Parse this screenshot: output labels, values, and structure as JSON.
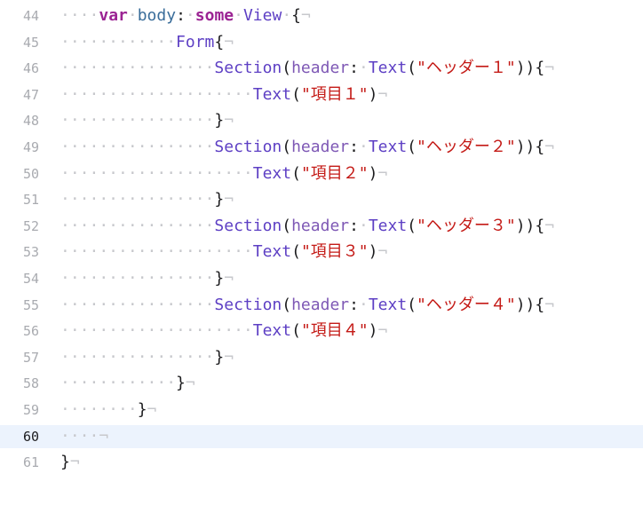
{
  "editor": {
    "lines": [
      {
        "num": "44",
        "indent": "····",
        "segments": [
          [
            "kw",
            "var"
          ],
          [
            "ws",
            "·"
          ],
          [
            "prop",
            "body"
          ],
          [
            "punc",
            ":"
          ],
          [
            "ws",
            "·"
          ],
          [
            "kw",
            "some"
          ],
          [
            "ws",
            "·"
          ],
          [
            "type",
            "View"
          ],
          [
            "ws",
            "·"
          ],
          [
            "punc",
            "{"
          ],
          [
            "eol",
            "¬"
          ]
        ]
      },
      {
        "num": "45",
        "indent": "············",
        "segments": [
          [
            "type",
            "Form"
          ],
          [
            "punc",
            "{"
          ],
          [
            "eol",
            "¬"
          ]
        ]
      },
      {
        "num": "46",
        "indent": "················",
        "segments": [
          [
            "type",
            "Section"
          ],
          [
            "punc",
            "("
          ],
          [
            "param",
            "header"
          ],
          [
            "punc",
            ":"
          ],
          [
            "ws",
            "·"
          ],
          [
            "type",
            "Text"
          ],
          [
            "punc",
            "("
          ],
          [
            "str",
            "\"ヘッダー１\""
          ],
          [
            "punc",
            "))"
          ],
          [
            "punc",
            "{"
          ],
          [
            "eol",
            "¬"
          ]
        ]
      },
      {
        "num": "47",
        "indent": "····················",
        "segments": [
          [
            "type",
            "Text"
          ],
          [
            "punc",
            "("
          ],
          [
            "str",
            "\"項目１\""
          ],
          [
            "punc",
            ")"
          ],
          [
            "eol",
            "¬"
          ]
        ]
      },
      {
        "num": "48",
        "indent": "················",
        "segments": [
          [
            "punc",
            "}"
          ],
          [
            "eol",
            "¬"
          ]
        ]
      },
      {
        "num": "49",
        "indent": "················",
        "segments": [
          [
            "type",
            "Section"
          ],
          [
            "punc",
            "("
          ],
          [
            "param",
            "header"
          ],
          [
            "punc",
            ":"
          ],
          [
            "ws",
            "·"
          ],
          [
            "type",
            "Text"
          ],
          [
            "punc",
            "("
          ],
          [
            "str",
            "\"ヘッダー２\""
          ],
          [
            "punc",
            "))"
          ],
          [
            "punc",
            "{"
          ],
          [
            "eol",
            "¬"
          ]
        ]
      },
      {
        "num": "50",
        "indent": "····················",
        "segments": [
          [
            "type",
            "Text"
          ],
          [
            "punc",
            "("
          ],
          [
            "str",
            "\"項目２\""
          ],
          [
            "punc",
            ")"
          ],
          [
            "eol",
            "¬"
          ]
        ]
      },
      {
        "num": "51",
        "indent": "················",
        "segments": [
          [
            "punc",
            "}"
          ],
          [
            "eol",
            "¬"
          ]
        ]
      },
      {
        "num": "52",
        "indent": "················",
        "segments": [
          [
            "type",
            "Section"
          ],
          [
            "punc",
            "("
          ],
          [
            "param",
            "header"
          ],
          [
            "punc",
            ":"
          ],
          [
            "ws",
            "·"
          ],
          [
            "type",
            "Text"
          ],
          [
            "punc",
            "("
          ],
          [
            "str",
            "\"ヘッダー３\""
          ],
          [
            "punc",
            "))"
          ],
          [
            "punc",
            "{"
          ],
          [
            "eol",
            "¬"
          ]
        ]
      },
      {
        "num": "53",
        "indent": "····················",
        "segments": [
          [
            "type",
            "Text"
          ],
          [
            "punc",
            "("
          ],
          [
            "str",
            "\"項目３\""
          ],
          [
            "punc",
            ")"
          ],
          [
            "eol",
            "¬"
          ]
        ]
      },
      {
        "num": "54",
        "indent": "················",
        "segments": [
          [
            "punc",
            "}"
          ],
          [
            "eol",
            "¬"
          ]
        ]
      },
      {
        "num": "55",
        "indent": "················",
        "segments": [
          [
            "type",
            "Section"
          ],
          [
            "punc",
            "("
          ],
          [
            "param",
            "header"
          ],
          [
            "punc",
            ":"
          ],
          [
            "ws",
            "·"
          ],
          [
            "type",
            "Text"
          ],
          [
            "punc",
            "("
          ],
          [
            "str",
            "\"ヘッダー４\""
          ],
          [
            "punc",
            "))"
          ],
          [
            "punc",
            "{"
          ],
          [
            "eol",
            "¬"
          ]
        ]
      },
      {
        "num": "56",
        "indent": "····················",
        "segments": [
          [
            "type",
            "Text"
          ],
          [
            "punc",
            "("
          ],
          [
            "str",
            "\"項目４\""
          ],
          [
            "punc",
            ")"
          ],
          [
            "eol",
            "¬"
          ]
        ]
      },
      {
        "num": "57",
        "indent": "················",
        "segments": [
          [
            "punc",
            "}"
          ],
          [
            "eol",
            "¬"
          ]
        ]
      },
      {
        "num": "58",
        "indent": "············",
        "segments": [
          [
            "punc",
            "}"
          ],
          [
            "eol",
            "¬"
          ]
        ]
      },
      {
        "num": "59",
        "indent": "········",
        "segments": [
          [
            "punc",
            "}"
          ],
          [
            "eol",
            "¬"
          ]
        ]
      },
      {
        "num": "60",
        "indent": "····",
        "segments": [
          [
            "eol",
            "¬"
          ]
        ],
        "current": true
      },
      {
        "num": "61",
        "indent": "",
        "segments": [
          [
            "punc",
            "}"
          ],
          [
            "eol",
            "¬"
          ]
        ]
      }
    ]
  },
  "colors": {
    "keyword": "#9b2393",
    "property": "#3a6d9a",
    "type": "#5d3fc4",
    "parameter": "#7e58b5",
    "string": "#c41a16",
    "invisible": "#c7c8cc",
    "current_line": "#ecf3fd"
  }
}
